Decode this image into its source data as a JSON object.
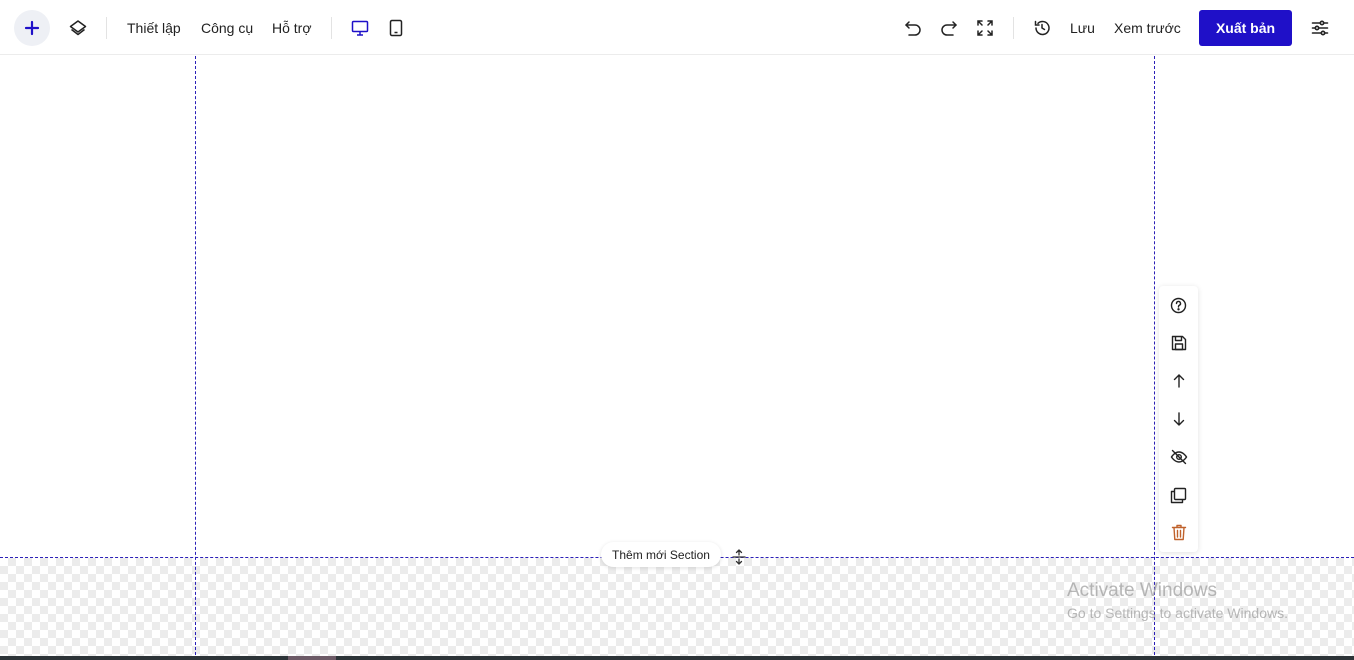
{
  "toolbar": {
    "add_icon": "plus-icon",
    "layers_icon": "layers-icon",
    "menu": [
      "Thiết lập",
      "Công cụ",
      "Hỗ trợ"
    ],
    "devices": [
      "desktop-icon",
      "tablet-icon"
    ],
    "active_device": "desktop",
    "undo_icon": "undo-icon",
    "redo_icon": "redo-icon",
    "fullscreen_icon": "fullscreen-icon",
    "history_icon": "history-icon",
    "save_label": "Lưu",
    "preview_label": "Xem trước",
    "publish_label": "Xuất bản",
    "settings_icon": "sliders-icon"
  },
  "canvas": {
    "add_section_label": "Thêm mới Section"
  },
  "section_tools": [
    "help-icon",
    "save-icon",
    "move-up-icon",
    "move-down-icon",
    "hide-icon",
    "duplicate-icon",
    "delete-icon"
  ],
  "watermark": {
    "line1": "Activate Windows",
    "line2": "Go to Settings to activate Windows."
  },
  "colors": {
    "accent": "#1f10c8",
    "guide": "#2b1fb8",
    "delete": "#c0622c"
  }
}
